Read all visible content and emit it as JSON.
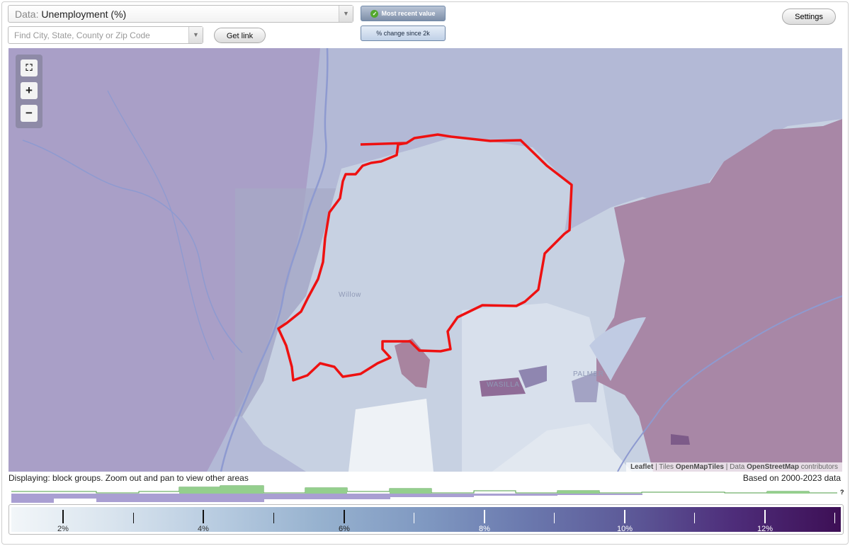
{
  "toolbar": {
    "data_prefix": "Data:",
    "data_value": "Unemployment (%)",
    "search_placeholder": "Find City, State, County or Zip Code",
    "get_link": "Get link",
    "mode_recent": "Most recent value",
    "mode_change": "% change since 2k",
    "settings": "Settings"
  },
  "map": {
    "labels": {
      "willow": "Willow",
      "wasilla": "WASILLA",
      "palmer": "PALMER"
    },
    "attribution": {
      "leaflet": "Leaflet",
      "tiles_prefix": "Tiles",
      "tiles": "OpenMapTiles",
      "data_prefix": "Data",
      "data": "OpenStreetMap",
      "contributors": "contributors"
    }
  },
  "status": {
    "displaying": "Displaying: block groups. Zoom out and pan to view other areas",
    "based_on": "Based on 2000-2023 data"
  },
  "histogram": {
    "question_mark": "?"
  },
  "legend": {
    "ticks": [
      "2%",
      "4%",
      "6%",
      "8%",
      "10%",
      "12%"
    ]
  },
  "colors": {
    "selection_outline": "#ee1111",
    "high_unemployment": "#a887a6",
    "histogram_green": "#94cf8d",
    "histogram_purple": "#a99fd2"
  }
}
